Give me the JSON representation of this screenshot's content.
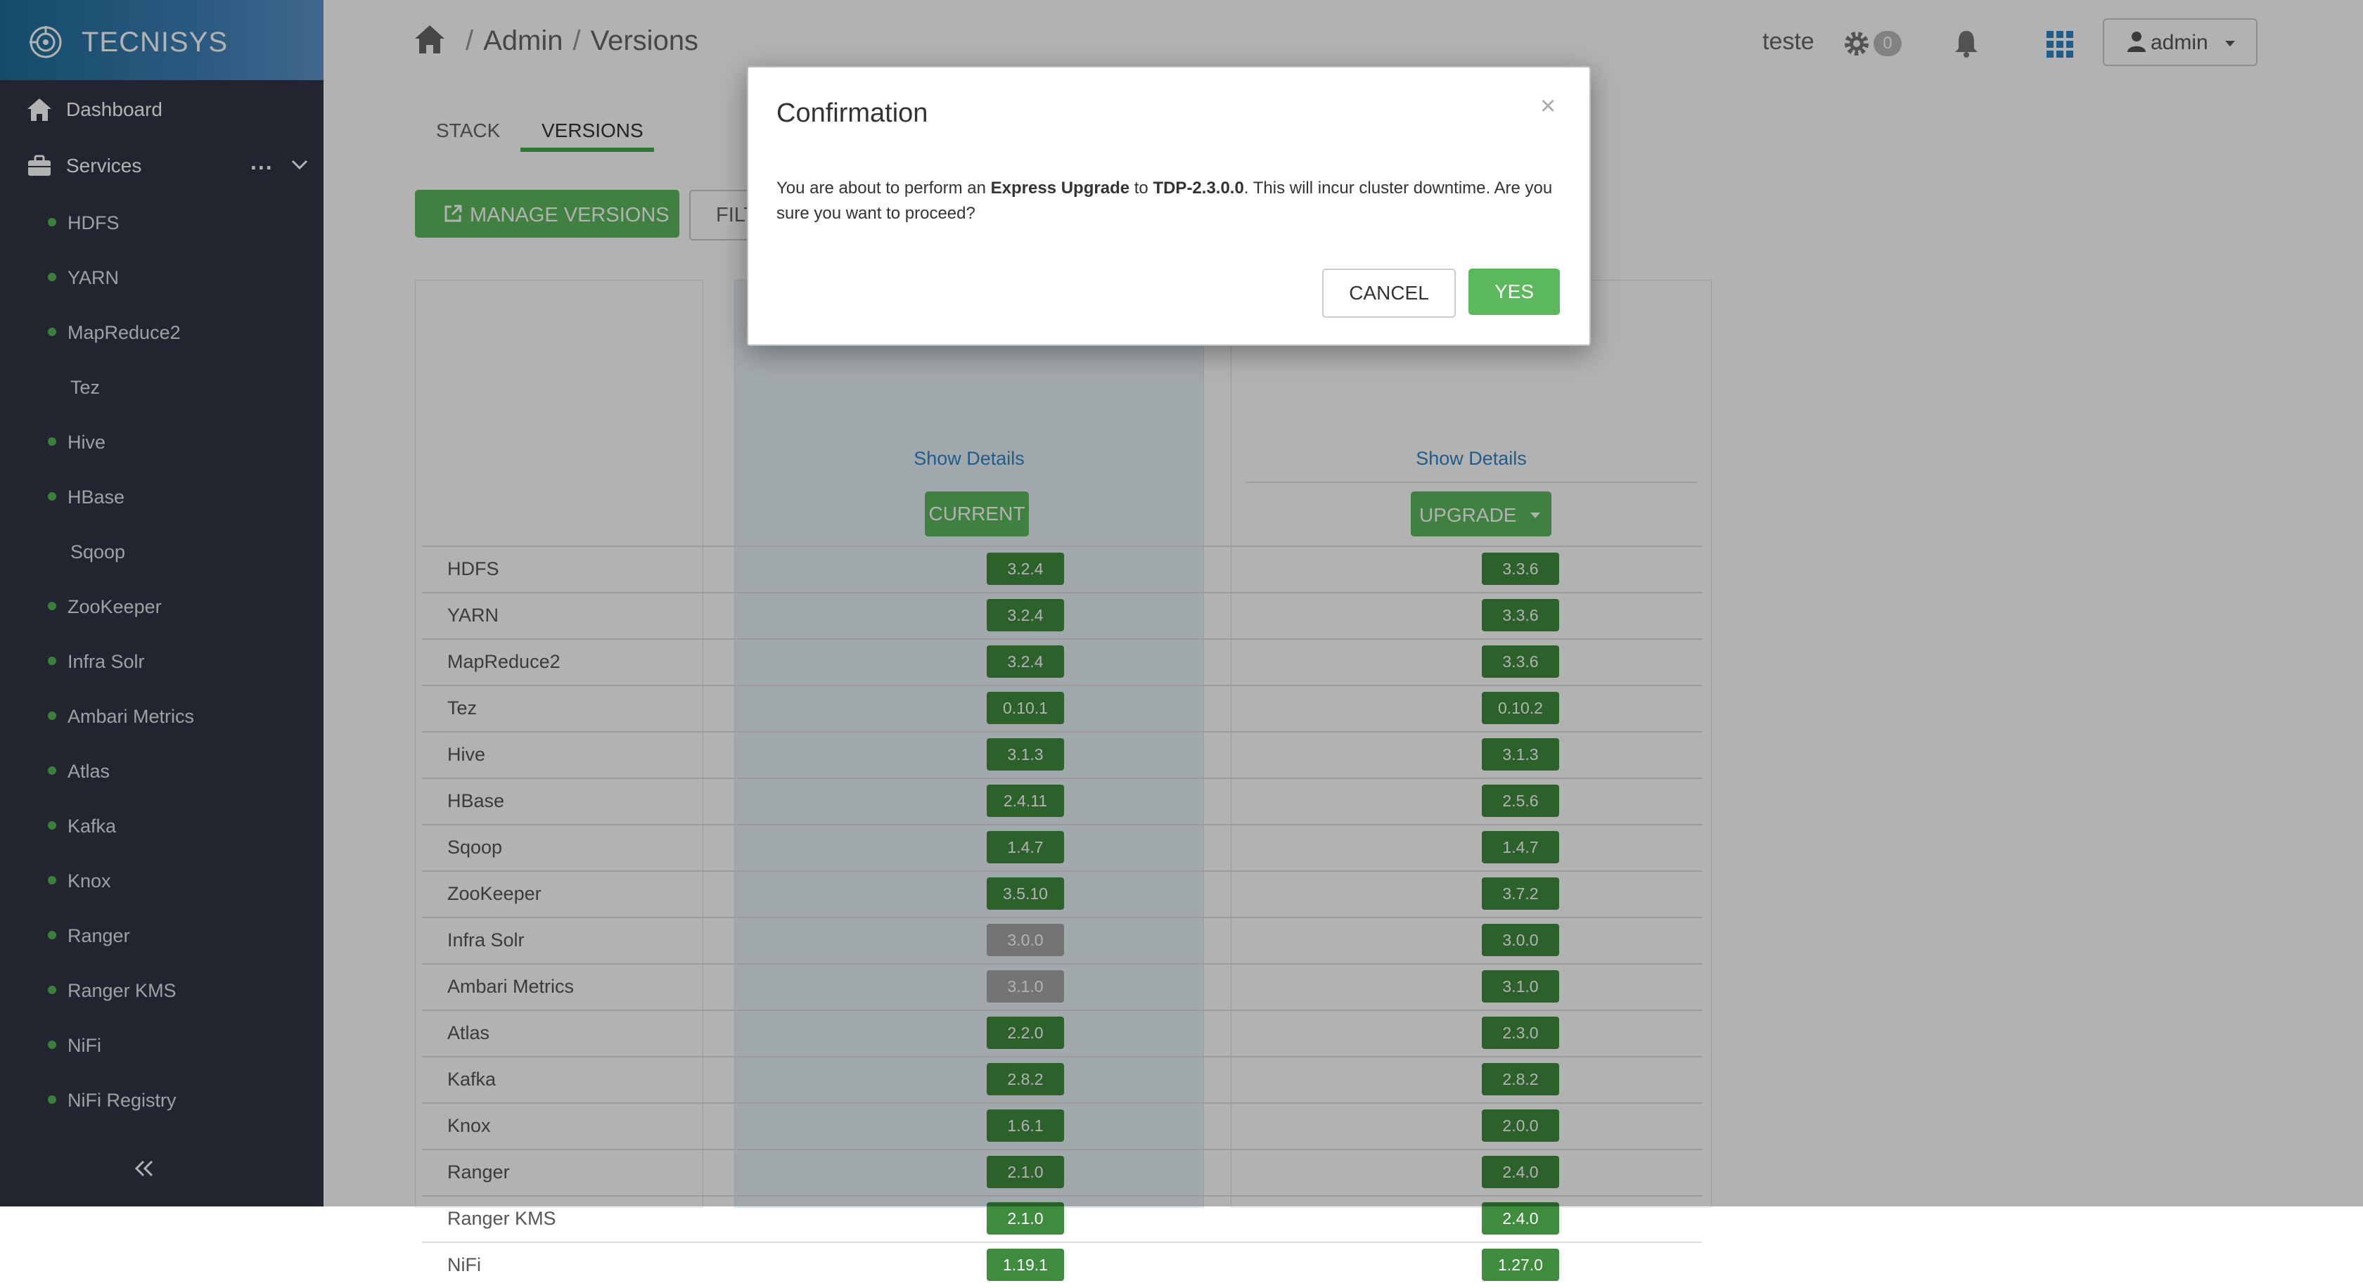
{
  "sidebar": {
    "brand": "TECNISYS",
    "dashboard_label": "Dashboard",
    "services_label": "Services",
    "services_more": "...",
    "services": [
      {
        "name": "HDFS",
        "dot": true
      },
      {
        "name": "YARN",
        "dot": true
      },
      {
        "name": "MapReduce2",
        "dot": true
      },
      {
        "name": "Tez",
        "dot": false
      },
      {
        "name": "Hive",
        "dot": true
      },
      {
        "name": "HBase",
        "dot": true
      },
      {
        "name": "Sqoop",
        "dot": false
      },
      {
        "name": "ZooKeeper",
        "dot": true
      },
      {
        "name": "Infra Solr",
        "dot": true
      },
      {
        "name": "Ambari Metrics",
        "dot": true
      },
      {
        "name": "Atlas",
        "dot": true
      },
      {
        "name": "Kafka",
        "dot": true
      },
      {
        "name": "Knox",
        "dot": true
      },
      {
        "name": "Ranger",
        "dot": true
      },
      {
        "name": "Ranger KMS",
        "dot": true
      },
      {
        "name": "NiFi",
        "dot": true
      },
      {
        "name": "NiFi Registry",
        "dot": true
      }
    ],
    "status_color": "#53b654",
    "icons": {
      "home": "home-icon",
      "services": "briefcase-icon",
      "collapse": "double-chevron-left-icon"
    }
  },
  "topbar": {
    "breadcrumb": [
      "Admin",
      "Versions"
    ],
    "user_text": "teste",
    "ops_count": "0",
    "admin_label": "admin"
  },
  "tabs": {
    "stack": "STACK",
    "versions": "VERSIONS"
  },
  "toolbar": {
    "manage_versions": "MANAGE VERSIONS",
    "filter_partial": "FILTER"
  },
  "versions": {
    "show_details": "Show Details",
    "current_label": "CURRENT",
    "upgrade_label": "UPGRADE",
    "rows": [
      {
        "service": "HDFS",
        "current": "3.2.4",
        "target": "3.3.6"
      },
      {
        "service": "YARN",
        "current": "3.2.4",
        "target": "3.3.6"
      },
      {
        "service": "MapReduce2",
        "current": "3.2.4",
        "target": "3.3.6"
      },
      {
        "service": "Tez",
        "current": "0.10.1",
        "target": "0.10.2"
      },
      {
        "service": "Hive",
        "current": "3.1.3",
        "target": "3.1.3"
      },
      {
        "service": "HBase",
        "current": "2.4.11",
        "target": "2.5.6"
      },
      {
        "service": "Sqoop",
        "current": "1.4.7",
        "target": "1.4.7"
      },
      {
        "service": "ZooKeeper",
        "current": "3.5.10",
        "target": "3.7.2"
      },
      {
        "service": "Infra Solr",
        "current": "3.0.0",
        "target": "3.0.0",
        "current_muted": true
      },
      {
        "service": "Ambari Metrics",
        "current": "3.1.0",
        "target": "3.1.0",
        "current_muted": true
      },
      {
        "service": "Atlas",
        "current": "2.2.0",
        "target": "2.3.0"
      },
      {
        "service": "Kafka",
        "current": "2.8.2",
        "target": "2.8.2"
      },
      {
        "service": "Knox",
        "current": "1.6.1",
        "target": "2.0.0"
      },
      {
        "service": "Ranger",
        "current": "2.1.0",
        "target": "2.4.0"
      },
      {
        "service": "Ranger KMS",
        "current": "2.1.0",
        "target": "2.4.0"
      },
      {
        "service": "NiFi",
        "current": "1.19.1",
        "target": "1.27.0"
      }
    ]
  },
  "modal": {
    "title": "Confirmation",
    "close": "×",
    "body_prefix": "You are about to perform an ",
    "body_upgrade_type": "Express Upgrade",
    "body_to": " to ",
    "body_version": "TDP-2.3.0.0",
    "body_suffix": ". This will incur cluster downtime. Are you sure you want to proceed?",
    "cancel": "CANCEL",
    "yes": "YES"
  },
  "colors": {
    "accent_green": "#5cb85c",
    "version_badge": "#3f8c3f",
    "muted_badge": "#a6a6a6",
    "link": "#2f86c8",
    "sidebar_bg": "#323544"
  }
}
